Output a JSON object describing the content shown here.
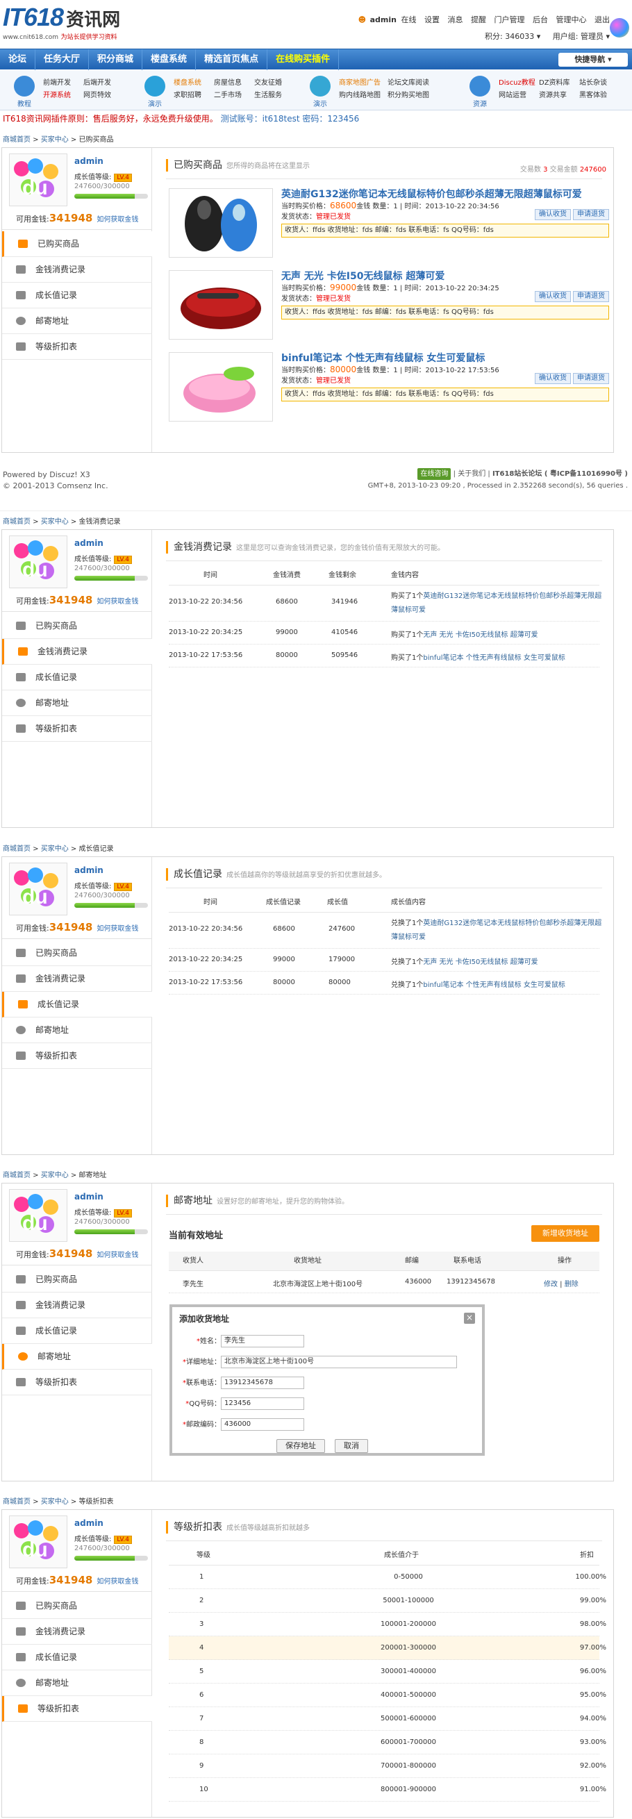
{
  "header": {
    "logo_main": "IT618",
    "logo_cn": "资讯网",
    "logo_url": "www.cnit618.com",
    "logo_slogan": "为站长提供学习资料",
    "user": "admin",
    "status": "在线",
    "top_links": [
      "设置",
      "消息",
      "提醒",
      "门户管理",
      "后台",
      "管理中心",
      "退出"
    ],
    "points": "积分: 346033",
    "group": "用户组: 管理员"
  },
  "mainnav": {
    "items": [
      "论坛",
      "任务大厅",
      "积分商城",
      "楼盘系统",
      "精选首页焦点",
      "在线购买插件"
    ],
    "active_index": 5,
    "quick": "快捷导航 ▾"
  },
  "catpanel": [
    {
      "label": "教程",
      "links": [
        "前端开发",
        "后端开发",
        "开源系统",
        "网页特效"
      ]
    },
    {
      "label": "演示",
      "links": [
        "楼盘系统",
        "房屋信息",
        "交友征婚",
        "求职招聘",
        "二手市场",
        "生活服务"
      ]
    },
    {
      "label": "演示",
      "links": [
        "商家地图广告",
        "论坛文库阅读",
        "购内线路地图",
        "积分购买地图"
      ]
    },
    {
      "label": "资源",
      "links": [
        "Discuz教程",
        "DZ资料库",
        "站长杂谈",
        "网站运营",
        "资源共享",
        "黑客体验"
      ]
    }
  ],
  "notice": {
    "text": "IT618资讯网插件原则：售后服务好，永远免费升级使用。",
    "test": "测试账号：it618test 密码：123456"
  },
  "user": {
    "name": "admin",
    "level_label": "成长值等级:",
    "level": "LV.4",
    "growth": "247600/300000",
    "growth_pct": 82.5,
    "money_label": "可用金钱:",
    "money": "341948",
    "money_link": "如何获取金钱"
  },
  "menu": [
    "已购买商品",
    "金钱消费记录",
    "成长值记录",
    "邮寄地址",
    "等级折扣表"
  ],
  "crumb": {
    "home": "商城首页",
    "buyer": "买家中心"
  },
  "sec1": {
    "crumb": "已购买商品",
    "title": "已购买商品",
    "subtitle": "您所得的商品将在这里显示",
    "count_label": "交易数",
    "count": "3",
    "amount_label": "交易金额",
    "amount": "247600",
    "products": [
      {
        "title": "英迪耐G132迷你笔记本无线鼠标特价包邮秒杀超薄无限超薄鼠标可爱",
        "price": "68600",
        "qty": "1",
        "time": "2013-10-22 20:34:56",
        "status": "管理已发货",
        "addr": "收货人：ffds 收货地址：fds 邮编：fds 联系电话：fs QQ号码：fds"
      },
      {
        "title": "无声 无光 卡佐I50无线鼠标 超薄可爱",
        "price": "99000",
        "qty": "1",
        "time": "2013-10-22 20:34:25",
        "status": "管理已发货",
        "addr": "收货人：ffds 收货地址：fds 邮编：fds 联系电话：fs QQ号码：fds"
      },
      {
        "title": "binful笔记本 个性无声有线鼠标 女生可爱鼠标",
        "price": "80000",
        "qty": "1",
        "time": "2013-10-22 17:53:56",
        "status": "管理已发货",
        "addr": "收货人：ffds 收货地址：fds 邮编：fds 联系电话：fs QQ号码：fds"
      }
    ],
    "price_label": "当时购买价格：",
    "unit": "金钱 数量：",
    "time_label": "时间：",
    "status_label": "发货状态：",
    "btn_confirm": "确认收货",
    "btn_refund": "申请退货"
  },
  "footer": {
    "powered": "Powered by Discuz! X3",
    "copy": "© 2001-2013 Comsenz Inc.",
    "online": "在线咨询",
    "about": "关于我们",
    "site": "IT618站长论坛 ( 粤ICP备11016990号 )",
    "gmt": "GMT+8, 2013-10-23 09:20 , Processed in 2.352268 second(s), 56 queries ."
  },
  "sec2": {
    "crumb": "金钱消费记录",
    "title": "金钱消费记录",
    "subtitle": "这里是您可以查询金钱消费记录，您的金钱价值有无限放大的可能。",
    "headers": [
      "时间",
      "金钱消费",
      "金钱剩余",
      "金钱内容"
    ],
    "rows": [
      {
        "time": "2013-10-22 20:34:56",
        "a": "68600",
        "b": "341946",
        "pre": "购买了1个",
        "item": "英迪耐G132迷你笔记本无线鼠标特价包邮秒杀超薄无限超薄鼠标可爱"
      },
      {
        "time": "2013-10-22 20:34:25",
        "a": "99000",
        "b": "410546",
        "pre": "购买了1个",
        "item": "无声 无光 卡佐I50无线鼠标 超薄可爱"
      },
      {
        "time": "2013-10-22 17:53:56",
        "a": "80000",
        "b": "509546",
        "pre": "购买了1个",
        "item": "binful笔记本 个性无声有线鼠标 女生可爱鼠标"
      }
    ]
  },
  "sec3": {
    "crumb": "成长值记录",
    "title": "成长值记录",
    "subtitle": "成长值越高你的等级就越高享受的折扣优惠就越多。",
    "headers": [
      "时间",
      "成长值记录",
      "成长值",
      "成长值内容"
    ],
    "rows": [
      {
        "time": "2013-10-22 20:34:56",
        "a": "68600",
        "b": "247600",
        "pre": "兑换了1个",
        "item": "英迪耐G132迷你笔记本无线鼠标特价包邮秒杀超薄无限超薄鼠标可爱"
      },
      {
        "time": "2013-10-22 20:34:25",
        "a": "99000",
        "b": "179000",
        "pre": "兑换了1个",
        "item": "无声 无光 卡佐I50无线鼠标 超薄可爱"
      },
      {
        "time": "2013-10-22 17:53:56",
        "a": "80000",
        "b": "80000",
        "pre": "兑换了1个",
        "item": "binful笔记本 个性无声有线鼠标 女生可爱鼠标"
      }
    ]
  },
  "sec4": {
    "crumb": "邮寄地址",
    "title": "邮寄地址",
    "subtitle": "设置好您的邮寄地址，提升您的购物体验。",
    "current": "当前有效地址",
    "new_btn": "新增收货地址",
    "headers": [
      "收货人",
      "收货地址",
      "邮编",
      "联系电话",
      "操作"
    ],
    "row": {
      "name": "李先生",
      "addr": "北京市海淀区上地十街100号",
      "zip": "436000",
      "phone": "13912345678",
      "edit": "修改",
      "del": "删除"
    },
    "modal": {
      "title": "添加收货地址",
      "close": "×",
      "fields": [
        {
          "label": "姓名：",
          "value": "李先生"
        },
        {
          "label": "详细地址：",
          "value": "北京市海淀区上地十街100号"
        },
        {
          "label": "联系电话：",
          "value": "13912345678"
        },
        {
          "label": "QQ号码：",
          "value": "123456"
        },
        {
          "label": "邮政编码：",
          "value": "436000"
        }
      ],
      "save": "保存地址",
      "cancel": "取消"
    }
  },
  "sec5": {
    "crumb": "等级折扣表",
    "title": "等级折扣表",
    "subtitle": "成长值等级越高折扣就越多",
    "headers": [
      "等级",
      "成长值介于",
      "折扣"
    ],
    "rows": [
      {
        "lv": "1",
        "range": "0-50000",
        "disc": "100.00%"
      },
      {
        "lv": "2",
        "range": "50001-100000",
        "disc": "99.00%"
      },
      {
        "lv": "3",
        "range": "100001-200000",
        "disc": "98.00%"
      },
      {
        "lv": "4",
        "range": "200001-300000",
        "disc": "97.00%"
      },
      {
        "lv": "5",
        "range": "300001-400000",
        "disc": "96.00%"
      },
      {
        "lv": "6",
        "range": "400001-500000",
        "disc": "95.00%"
      },
      {
        "lv": "7",
        "range": "500001-600000",
        "disc": "94.00%"
      },
      {
        "lv": "8",
        "range": "600001-700000",
        "disc": "93.00%"
      },
      {
        "lv": "9",
        "range": "700001-800000",
        "disc": "92.00%"
      },
      {
        "lv": "10",
        "range": "800001-900000",
        "disc": "91.00%"
      }
    ],
    "highlight_index": 3
  },
  "colors": {
    "accent": "#2d6cb3",
    "orange": "#f7910e",
    "price": "#ff6600"
  }
}
